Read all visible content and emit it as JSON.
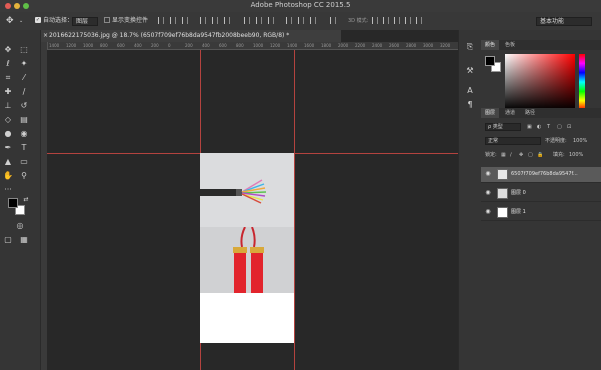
{
  "app": {
    "title": "Adobe Photoshop CC 2015.5"
  },
  "options_bar": {
    "move_icon": "move-tool-icon",
    "auto_select_label": "自动选择：",
    "auto_select_value": "图层",
    "show_transform_label": "显示变换控件",
    "workspace_value": "基本功能"
  },
  "document": {
    "tab_title": "2016622175036.jpg @ 18.7% (6507f709ef76b8da9547fb2008beeb90, RGB/8) *",
    "ruler_labels": [
      "1400",
      "1200",
      "1000",
      "800",
      "600",
      "400",
      "200",
      "0",
      "200",
      "400",
      "600",
      "800",
      "1000",
      "1200",
      "1400",
      "1600",
      "1800",
      "2000",
      "2200",
      "2400",
      "2600",
      "2800",
      "3000",
      "3200"
    ]
  },
  "color_panel": {
    "tabs": [
      "颜色",
      "色板"
    ],
    "colors": {
      "foreground": "#000000",
      "background": "#ffffff",
      "accent": "#b4433f"
    }
  },
  "layers_panel": {
    "tabs": [
      "图层",
      "通道",
      "路径"
    ],
    "filter_label": "ρ 类型",
    "blend_mode": "正常",
    "opacity_label": "不透明度:",
    "opacity_value": "100%",
    "lock_label": "锁定:",
    "fill_label": "填充:",
    "fill_value": "100%",
    "layers": [
      {
        "name": "6507f709ef76b8da9547f..."
      },
      {
        "name": "图层 0"
      },
      {
        "name": "图层 1"
      }
    ]
  }
}
